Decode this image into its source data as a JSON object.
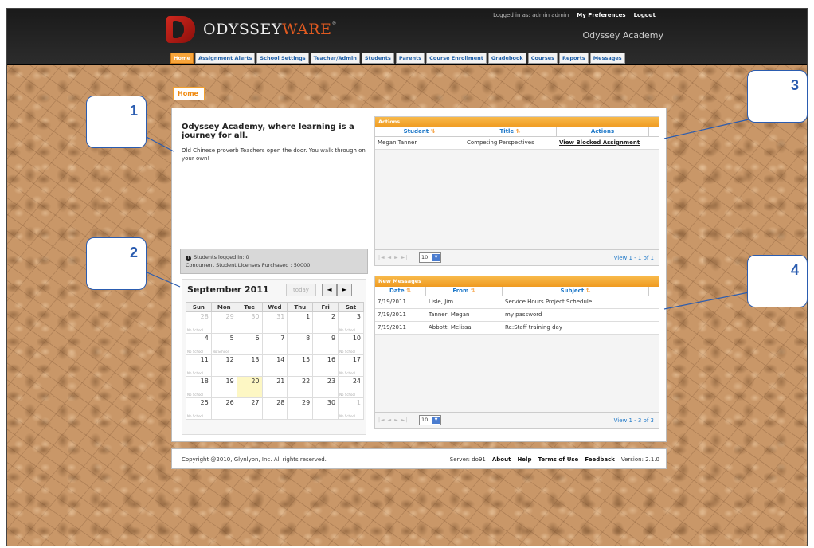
{
  "header": {
    "logo_text_main": "ODYSSEY",
    "logo_text_accent": "WARE",
    "logo_reg": "®",
    "logged_in": "Logged in as: admin admin",
    "my_preferences": "My Preferences",
    "logout": "Logout",
    "school_name": "Odyssey Academy"
  },
  "tabs": [
    {
      "label": "Home",
      "active": true
    },
    {
      "label": "Assignment Alerts"
    },
    {
      "label": "School Settings"
    },
    {
      "label": "Teacher/Admin"
    },
    {
      "label": "Students"
    },
    {
      "label": "Parents"
    },
    {
      "label": "Course Enrollment"
    },
    {
      "label": "Gradebook"
    },
    {
      "label": "Courses"
    },
    {
      "label": "Reports"
    },
    {
      "label": "Messages"
    }
  ],
  "page_tab": "Home",
  "welcome": {
    "tagline": "Odyssey Academy, where learning is a journey for all.",
    "proverb": "Old Chinese proverb Teachers open the door. You walk through on your own!"
  },
  "stats": {
    "logged_in": "Students logged in: 0",
    "licenses": "Concurrent Student Licenses Purchased : 50000"
  },
  "calendar": {
    "title": "September 2011",
    "today_label": "today",
    "prev": "◄",
    "next": "►",
    "weekdays": [
      "Sun",
      "Mon",
      "Tue",
      "Wed",
      "Thu",
      "Fri",
      "Sat"
    ],
    "weeks": [
      [
        "28",
        "29",
        "30",
        "31",
        "1",
        "2",
        "3"
      ],
      [
        "4",
        "5",
        "6",
        "7",
        "8",
        "9",
        "10"
      ],
      [
        "11",
        "12",
        "13",
        "14",
        "15",
        "16",
        "17"
      ],
      [
        "18",
        "19",
        "20",
        "21",
        "22",
        "23",
        "24"
      ],
      [
        "25",
        "26",
        "27",
        "28",
        "29",
        "30",
        "1"
      ]
    ],
    "note": "No School"
  },
  "actions": {
    "title": "Actions",
    "columns": [
      "Student",
      "Title",
      "Actions"
    ],
    "rows": [
      [
        "Megan Tanner",
        "Competing Perspectives",
        "View Blocked Assignment"
      ]
    ],
    "page_size": "10",
    "view": "View 1 - 1 of 1"
  },
  "messages": {
    "title": "New Messages",
    "columns": [
      "Date",
      "From",
      "Subject"
    ],
    "rows": [
      [
        "7/19/2011",
        "Lisle, Jim",
        "Service Hours Project Schedule"
      ],
      [
        "7/19/2011",
        "Tanner, Megan",
        "my password"
      ],
      [
        "7/19/2011",
        "Abbott, Melissa",
        "Re:Staff training day"
      ]
    ],
    "page_size": "10",
    "view": "View 1 - 3 of 3"
  },
  "footer": {
    "copyright": "Copyright @2010, Glynlyon, Inc. All rights reserved.",
    "server": "Server: do91",
    "about": "About",
    "help": "Help",
    "terms": "Terms of Use",
    "feedback": "Feedback",
    "version": "Version: 2.1.0"
  },
  "callouts": [
    "1",
    "2",
    "3",
    "4"
  ],
  "colors": {
    "accent_orange": "#ef9a20",
    "link_blue": "#1e78c8",
    "callout_blue": "#2a5cb0"
  }
}
